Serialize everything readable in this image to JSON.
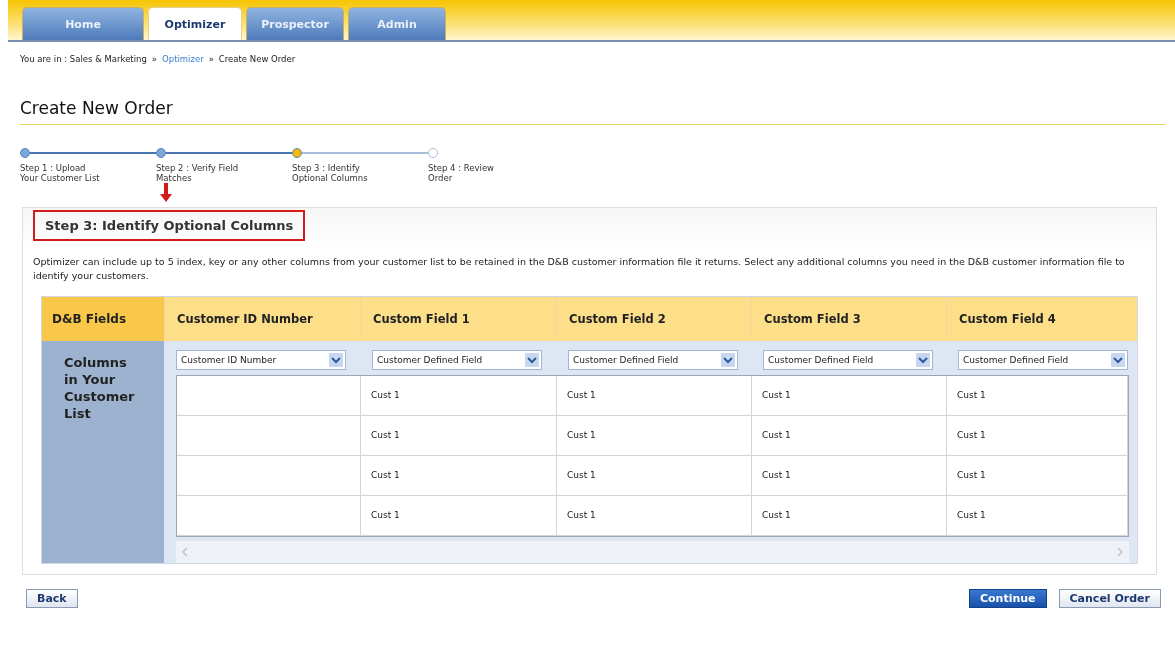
{
  "tabs": [
    {
      "label": "Home",
      "selected": false
    },
    {
      "label": "Optimizer",
      "selected": true
    },
    {
      "label": "Prospector",
      "selected": false
    },
    {
      "label": "Admin",
      "selected": false
    }
  ],
  "breadcrumb": {
    "prefix": "You are in : Sales & Marketing",
    "separator": "»",
    "link": "Optimizer",
    "current": "Create New Order"
  },
  "page_title": "Create New Order",
  "steps": [
    {
      "label": "Step 1 : Upload Your Customer List",
      "completed": true,
      "selected": false
    },
    {
      "label": "Step 2 : Verify Field Matches",
      "completed": true,
      "selected": false
    },
    {
      "label": "Step 3 : Identify Optional Columns",
      "completed": false,
      "selected": true
    },
    {
      "label": "Step 4 : Review Order",
      "completed": false,
      "selected": false
    }
  ],
  "section": {
    "title": "Step 3: Identify Optional Columns",
    "description": "Optimizer can include up to 5 index, key or any other columns from your customer list to be retained in the D&B customer information file it returns. Select any additional columns you need in the D&B customer information file to identify your customers."
  },
  "table": {
    "corner": "D&B Fields",
    "side_label": "Columns in Your Customer List",
    "columns": [
      {
        "title": "Customer ID Number",
        "dropdown": "Customer ID Number"
      },
      {
        "title": "Custom Field 1",
        "dropdown": "Customer Defined Field"
      },
      {
        "title": "Custom Field 2",
        "dropdown": "Customer Defined Field"
      },
      {
        "title": "Custom Field 3",
        "dropdown": "Customer Defined Field"
      },
      {
        "title": "Custom Field 4",
        "dropdown": "Customer Defined Field"
      }
    ],
    "rows": [
      {
        "cells": [
          "",
          "Cust 1",
          "Cust 1",
          "Cust 1",
          "Cust 1"
        ]
      },
      {
        "cells": [
          "",
          "Cust 1",
          "Cust 1",
          "Cust 1",
          "Cust 1"
        ]
      },
      {
        "cells": [
          "",
          "Cust 1",
          "Cust 1",
          "Cust 1",
          "Cust 1"
        ]
      },
      {
        "cells": [
          "",
          "Cust 1",
          "Cust 1",
          "Cust 1",
          "Cust 1"
        ]
      }
    ]
  },
  "buttons": {
    "back": "Back",
    "continue": "Continue",
    "cancel": "Cancel Order"
  }
}
